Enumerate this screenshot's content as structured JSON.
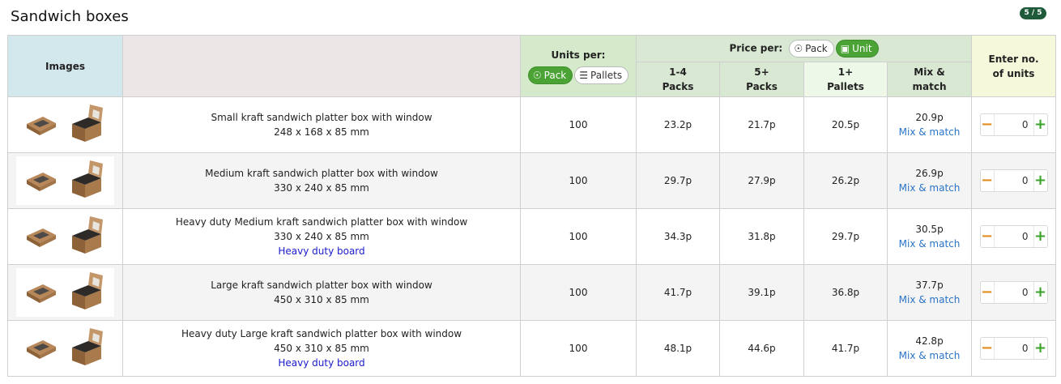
{
  "page": {
    "title": "Sandwich boxes",
    "pager": "5 / 5"
  },
  "header": {
    "images": "Images",
    "units_per": "Units per:",
    "units_toggle": [
      {
        "label": "Pack",
        "icon": "pack-icon",
        "active": true
      },
      {
        "label": "Pallets",
        "icon": "pallet-icon",
        "active": false
      }
    ],
    "price_per": "Price per:",
    "price_toggle": [
      {
        "label": "Pack",
        "icon": "pack-icon",
        "active": false
      },
      {
        "label": "Unit",
        "icon": "unit-box-icon",
        "active": true
      }
    ],
    "price_columns": [
      {
        "line1": "1-4",
        "line2": "Packs"
      },
      {
        "line1": "5+",
        "line2": "Packs"
      },
      {
        "line1": "1+",
        "line2": "Pallets"
      },
      {
        "line1": "Mix &",
        "line2": "match"
      }
    ],
    "enter_units": "Enter no. of units"
  },
  "products": [
    {
      "name": "Small kraft sandwich platter box with window",
      "size": "248 x 168 x 85 mm",
      "note": "",
      "units": "100",
      "p1": "23.2p",
      "p2": "21.7p",
      "p3": "20.5p",
      "mix": "20.9p",
      "mix_link": "Mix & match",
      "qty": "0"
    },
    {
      "name": "Medium kraft sandwich platter box with window",
      "size": "330 x 240 x 85 mm",
      "note": "",
      "units": "100",
      "p1": "29.7p",
      "p2": "27.9p",
      "p3": "26.2p",
      "mix": "26.9p",
      "mix_link": "Mix & match",
      "qty": "0"
    },
    {
      "name": "Heavy duty Medium kraft sandwich platter box with window",
      "size": "330 x 240 x 85 mm",
      "note": "Heavy duty board",
      "units": "100",
      "p1": "34.3p",
      "p2": "31.8p",
      "p3": "29.7p",
      "mix": "30.5p",
      "mix_link": "Mix & match",
      "qty": "0"
    },
    {
      "name": "Large kraft sandwich platter box with window",
      "size": "450 x 310 x 85 mm",
      "note": "",
      "units": "100",
      "p1": "41.7p",
      "p2": "39.1p",
      "p3": "36.8p",
      "mix": "37.7p",
      "mix_link": "Mix & match",
      "qty": "0"
    },
    {
      "name": "Heavy duty Large kraft sandwich platter box with window",
      "size": "450 x 310 x 85 mm",
      "note": "Heavy duty board",
      "units": "100",
      "p1": "48.1p",
      "p2": "44.6p",
      "p3": "41.7p",
      "mix": "42.8p",
      "mix_link": "Mix & match",
      "qty": "0"
    }
  ],
  "colors": {
    "accent_green": "#4aa334",
    "minus_orange": "#e28a1a",
    "link_blue": "#2a74c7",
    "note_blue": "#1a1acc"
  }
}
